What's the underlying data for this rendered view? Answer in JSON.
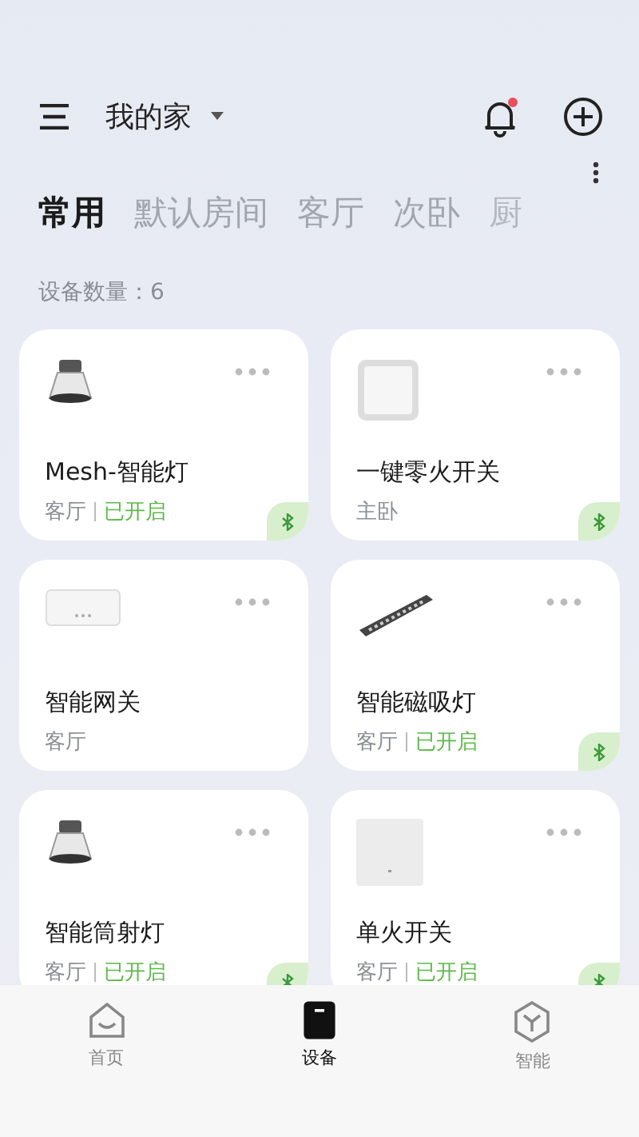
{
  "header": {
    "home": "我的家",
    "notification_unread": true
  },
  "tabs": [
    {
      "label": "常用",
      "selected": true
    },
    {
      "label": "默认房间",
      "selected": false
    },
    {
      "label": "客厅",
      "selected": false
    },
    {
      "label": "次卧",
      "selected": false
    },
    {
      "label": "厨",
      "selected": false
    }
  ],
  "device_count": "设备数量：6",
  "devices": [
    {
      "name": "Mesh-智能灯",
      "kind": "downlight",
      "room": "客厅",
      "state": "已开启",
      "bluetooth": true
    },
    {
      "name": "一键零火开关",
      "kind": "switch",
      "room": "主卧",
      "bluetooth": true
    },
    {
      "name": "智能网关",
      "kind": "gateway",
      "room": "客厅",
      "bluetooth": false
    },
    {
      "name": "智能磁吸灯",
      "kind": "strip",
      "room": "客厅",
      "state": "已开启",
      "bluetooth": true
    },
    {
      "name": "智能筒射灯",
      "kind": "downlight",
      "room": "客厅",
      "state": "已开启",
      "bluetooth": true
    },
    {
      "name": "单火开关",
      "kind": "panel",
      "room": "客厅",
      "state": "已开启",
      "bluetooth": true
    }
  ],
  "bottom_nav": [
    {
      "label": "首页",
      "kind": "home",
      "selected": false
    },
    {
      "label": "设备",
      "kind": "device",
      "selected": true
    },
    {
      "label": "智能",
      "kind": "smart",
      "selected": false
    }
  ]
}
